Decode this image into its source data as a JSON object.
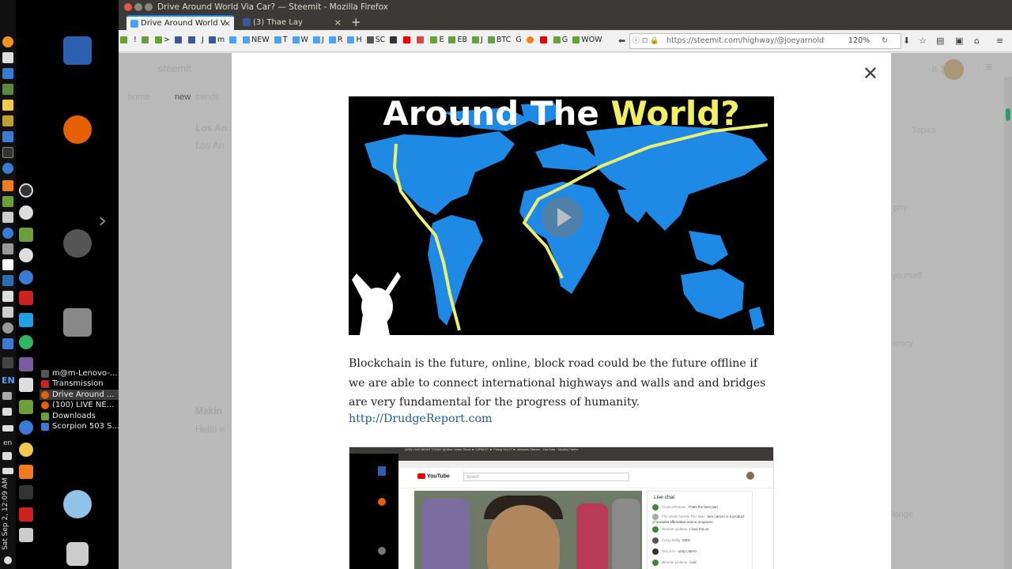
{
  "window": {
    "title": "Drive Around World Via Car? — Steemit - Mozilla Firefox"
  },
  "tabs": [
    {
      "label": "Drive Around World V",
      "active": true
    },
    {
      "label": "(3) Thae Lay",
      "active": false
    }
  ],
  "bookmarks": [
    "!",
    ">",
    "J",
    "m",
    "NEW",
    "T",
    "W",
    "J",
    "R",
    "H",
    "SC",
    "E",
    "EB",
    "J",
    "BTC",
    "G",
    "G",
    "WOW"
  ],
  "urlbar": {
    "url": "https://steemit.com/highway/@joeyarnoldvn",
    "zoom": "120%"
  },
  "background_page": {
    "logo": "steemit",
    "nav": [
      "home",
      "new",
      "trending"
    ],
    "right_link": "a Story",
    "left_snippets": [
      "Los An",
      "Los An",
      "Makin",
      "Hello e"
    ],
    "right_snippets": [
      "Topics",
      "phy",
      "yourself",
      "rency",
      "lenge"
    ]
  },
  "modal": {
    "video": {
      "title_part1": "Around The",
      "title_part2": "World?"
    },
    "paragraph": "Blockchain is the future, online, block road could be the future offline if we are able to connect international highways and walls and and bridges are very fundamental for the progress of humanity.",
    "link": "http://DrudgeReport.com",
    "screenshot": {
      "window_title": "(100) LIVE NEWS TODAY @ Alex Jones Show ► 12PM ET ► Friday 9/1/17 ► Infowars Stream - YouTube - Mozilla Firefox",
      "yt_brand": "YouTube",
      "search_placeholder": "Search",
      "live_chat_title": "Live chat",
      "chat": [
        {
          "name": "TropicalToucan",
          "msg": "Thats the best part"
        },
        {
          "name": "The World Needs This Man",
          "msg": "ben carson is a product of socialist affirmative action programs"
        },
        {
          "name": "slimmer pickens",
          "msg": "i love this at"
        },
        {
          "name": "Crazy Eddy",
          "msg": "DED"
        },
        {
          "name": "NIN JAH",
          "msg": "unity LMAO"
        },
        {
          "name": "slimmer pickens",
          "msg": "cool"
        }
      ]
    }
  },
  "launcher": {
    "windows": [
      "m@m-Lenovo-...",
      "Transmission",
      "Drive Around ...",
      "(100) LIVE NE...",
      "Downloads",
      "Scorpion 503 S..."
    ]
  },
  "panel": {
    "lang": "EN",
    "lang2": "en",
    "clock": "Sat Sep 2, 12:09 AM"
  },
  "colors": {
    "accent_tab": "#0a84ff",
    "link": "#1a5c9c",
    "video_highlight": "#f2f062",
    "map_blue": "#1e8ae6"
  }
}
